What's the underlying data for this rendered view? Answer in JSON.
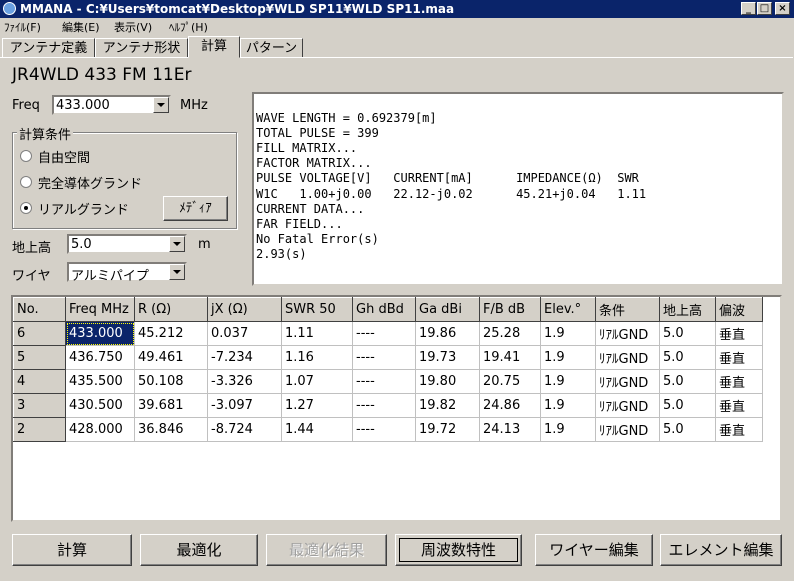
{
  "window": {
    "title": "MMANA - C:¥Users¥tomcat¥Desktop¥WLD SP11¥WLD SP11.maa",
    "minimize_glyph": "_",
    "maximize_glyph": "□",
    "close_glyph": "×"
  },
  "menu": [
    "ﾌｧｲﾙ(F)",
    "編集(E)",
    "表示(V)",
    "ﾍﾙﾌﾟ(H)"
  ],
  "tabs": [
    "アンテナ定義",
    "アンテナ形状",
    "計算",
    "パターン"
  ],
  "active_tab": "計算",
  "antenna_name": "JR4WLD 433 FM 11Er",
  "freq": {
    "label": "Freq",
    "value": "433.000",
    "unit": "MHz"
  },
  "conditions": {
    "legend": "計算条件",
    "options": [
      "自由空間",
      "完全導体グランド",
      "リアルグランド"
    ],
    "selected_index": 2,
    "media_button": "ﾒﾃﾞｨｱ"
  },
  "height": {
    "label": "地上高",
    "value": "5.0",
    "unit": "m"
  },
  "wire": {
    "label": "ワイヤ",
    "value": "アルミパイプ"
  },
  "output_lines": [
    "WAVE LENGTH = 0.692379[m]",
    "TOTAL PULSE = 399",
    "FILL MATRIX...",
    "FACTOR MATRIX...",
    "PULSE VOLTAGE[V]   CURRENT[mA]      IMPEDANCE(Ω)  SWR",
    "W1C   1.00+j0.00   22.12-j0.02      45.21+j0.04   1.11",
    "CURRENT DATA...",
    "FAR FIELD...",
    "No Fatal Error(s)",
    "2.93(s)"
  ],
  "table": {
    "columns": [
      "No.",
      "Freq MHz",
      "R (Ω)",
      "jX (Ω)",
      "SWR 50",
      "Gh dBd",
      "Ga dBi",
      "F/B dB",
      "Elev.°",
      "条件",
      "地上高",
      "偏波"
    ],
    "rows": [
      [
        "6",
        "433.000",
        "45.212",
        "0.037",
        "1.11",
        "----",
        "19.86",
        "25.28",
        "1.9",
        "ﾘｱﾙGND",
        "5.0",
        "垂直"
      ],
      [
        "5",
        "436.750",
        "49.461",
        "-7.234",
        "1.16",
        "----",
        "19.73",
        "19.41",
        "1.9",
        "ﾘｱﾙGND",
        "5.0",
        "垂直"
      ],
      [
        "4",
        "435.500",
        "50.108",
        "-3.326",
        "1.07",
        "----",
        "19.80",
        "20.75",
        "1.9",
        "ﾘｱﾙGND",
        "5.0",
        "垂直"
      ],
      [
        "3",
        "430.500",
        "39.681",
        "-3.097",
        "1.27",
        "----",
        "19.82",
        "24.86",
        "1.9",
        "ﾘｱﾙGND",
        "5.0",
        "垂直"
      ],
      [
        "2",
        "428.000",
        "36.846",
        "-8.724",
        "1.44",
        "----",
        "19.72",
        "24.13",
        "1.9",
        "ﾘｱﾙGND",
        "5.0",
        "垂直"
      ]
    ]
  },
  "buttons": {
    "calc": "計算",
    "optimize": "最適化",
    "optimize_result": "最適化結果",
    "freq_char": "周波数特性",
    "wire_edit": "ワイヤー編集",
    "element_edit": "エレメント編集"
  }
}
